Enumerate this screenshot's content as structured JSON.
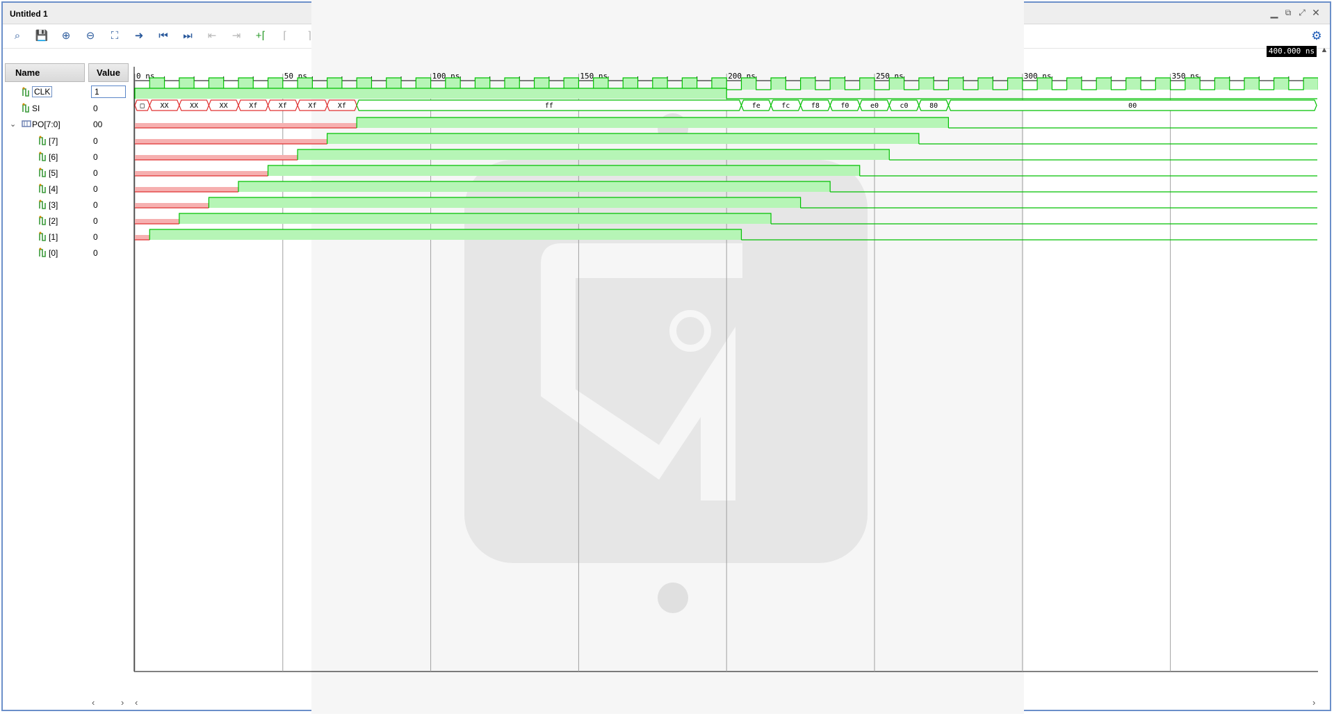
{
  "window": {
    "title": "Untitled 1",
    "controls": [
      "minimize-icon",
      "restore-icon",
      "maximize-icon",
      "close-icon"
    ]
  },
  "toolbar": {
    "tools": [
      {
        "name": "search-icon",
        "glyph": "⌕",
        "enabled": true
      },
      {
        "name": "save-icon",
        "glyph": "💾",
        "enabled": true
      },
      {
        "name": "zoom-in-icon",
        "glyph": "⊕",
        "enabled": true
      },
      {
        "name": "zoom-out-icon",
        "glyph": "⊖",
        "enabled": true
      },
      {
        "name": "zoom-fit-icon",
        "glyph": "⛶",
        "enabled": true
      },
      {
        "name": "go-to-cursor-icon",
        "glyph": "➜",
        "enabled": true
      },
      {
        "name": "go-to-time-0-icon",
        "glyph": "⏮",
        "enabled": true
      },
      {
        "name": "go-to-last-time-icon",
        "glyph": "⏭",
        "enabled": true
      },
      {
        "name": "previous-transition-icon",
        "glyph": "⇤",
        "enabled": false
      },
      {
        "name": "next-transition-icon",
        "glyph": "⇥",
        "enabled": false
      },
      {
        "name": "add-marker-icon",
        "glyph": "+⌈",
        "enabled": true,
        "green": true
      },
      {
        "name": "previous-marker-icon",
        "glyph": "⌈",
        "enabled": false
      },
      {
        "name": "next-marker-icon",
        "glyph": "⌉",
        "enabled": false
      },
      {
        "name": "swap-cursors-icon",
        "glyph": "⊢",
        "enabled": false
      }
    ]
  },
  "headers": {
    "name": "Name",
    "value": "Value"
  },
  "cursor_time": "400.000 ns",
  "timeline": {
    "ticks": [
      "0 ns",
      "50 ns",
      "100 ns",
      "150 ns",
      "200 ns",
      "250 ns",
      "300 ns",
      "350 ns"
    ]
  },
  "signals": [
    {
      "name": "CLK",
      "value": "1"
    },
    {
      "name": "SI",
      "value": "0"
    },
    {
      "name": "PO[7:0]",
      "value": "00"
    },
    {
      "name": "[7]",
      "value": "0"
    },
    {
      "name": "[6]",
      "value": "0"
    },
    {
      "name": "[5]",
      "value": "0"
    },
    {
      "name": "[4]",
      "value": "0"
    },
    {
      "name": "[3]",
      "value": "0"
    },
    {
      "name": "[2]",
      "value": "0"
    },
    {
      "name": "[1]",
      "value": "0"
    },
    {
      "name": "[0]",
      "value": "0"
    }
  ],
  "bus_values": [
    "□",
    "XX",
    "XX",
    "XX",
    "Xf",
    "Xf",
    "Xf",
    "Xf",
    "ff",
    "fe",
    "fc",
    "f8",
    "f0",
    "e0",
    "c0",
    "80",
    "00"
  ],
  "colors": {
    "wave_green": "#00c000",
    "fill_green": "#b6f5b6",
    "wave_red": "#e03030",
    "fill_red": "#f6b0b0",
    "grid": "#a0a0a0"
  }
}
